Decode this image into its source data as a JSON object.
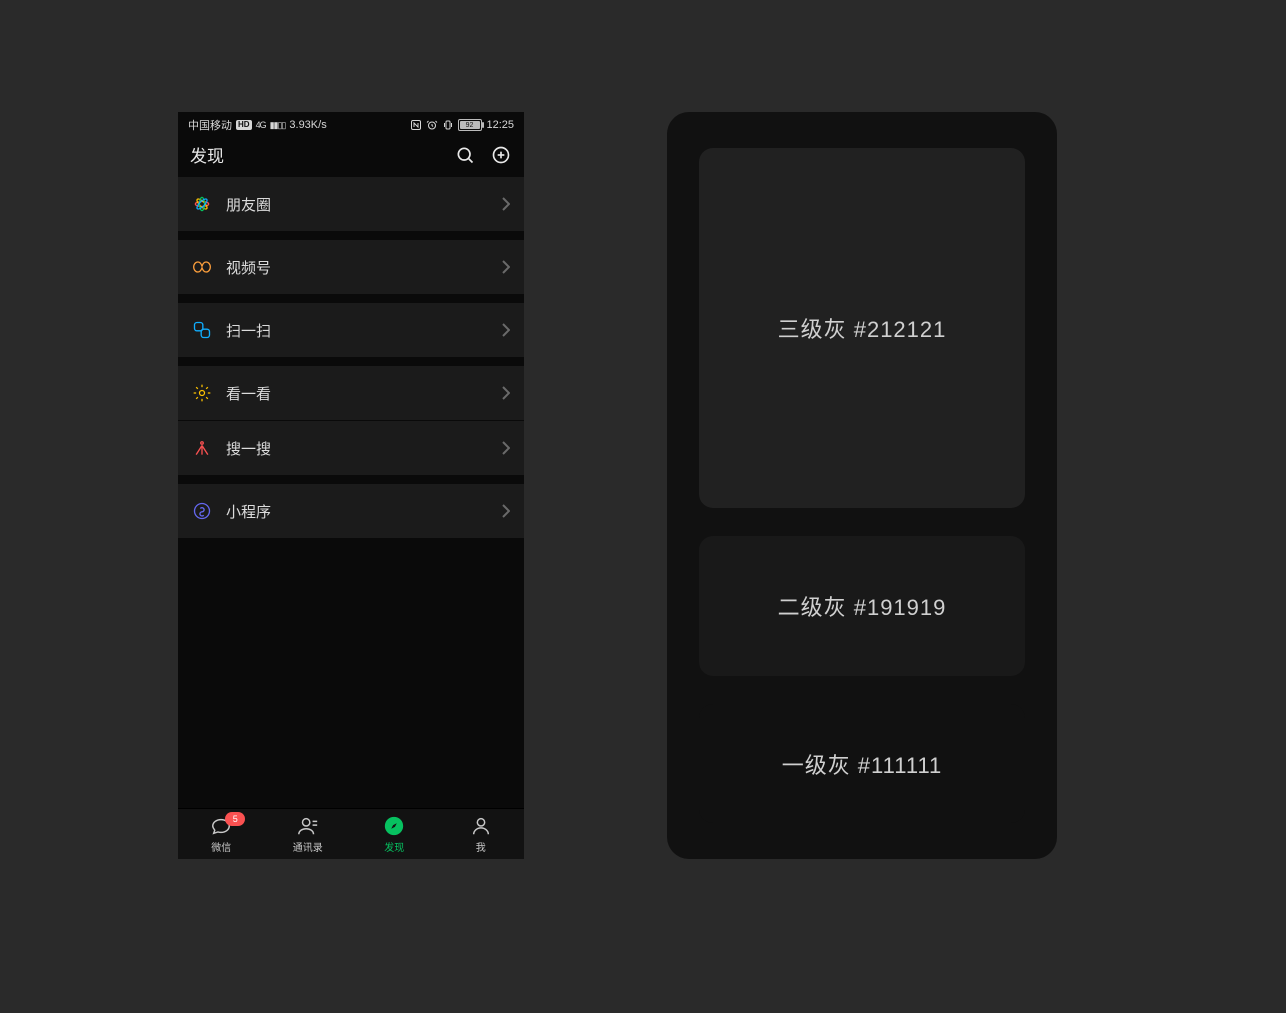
{
  "statusbar": {
    "carrier": "中国移动",
    "hd": "HD",
    "net": "4G",
    "speed": "3.93K/s",
    "battery_pct": "92",
    "time": "12:25"
  },
  "navbar": {
    "title": "发现"
  },
  "rows": {
    "moments": "朋友圈",
    "channels": "视频号",
    "scan": "扫一扫",
    "topstories": "看一看",
    "search": "搜一搜",
    "miniprogram": "小程序"
  },
  "tabs": {
    "chat": "微信",
    "contacts": "通讯录",
    "discover": "发现",
    "me": "我",
    "chat_badge": "5"
  },
  "swatches": {
    "level3": "三级灰 #212121",
    "level2": "二级灰 #191919",
    "level1": "一级灰 #111111"
  },
  "colors": {
    "accent": "#07c160",
    "badge": "#fa5151",
    "gray1": "#111111",
    "gray2": "#191919",
    "gray3": "#212121"
  }
}
